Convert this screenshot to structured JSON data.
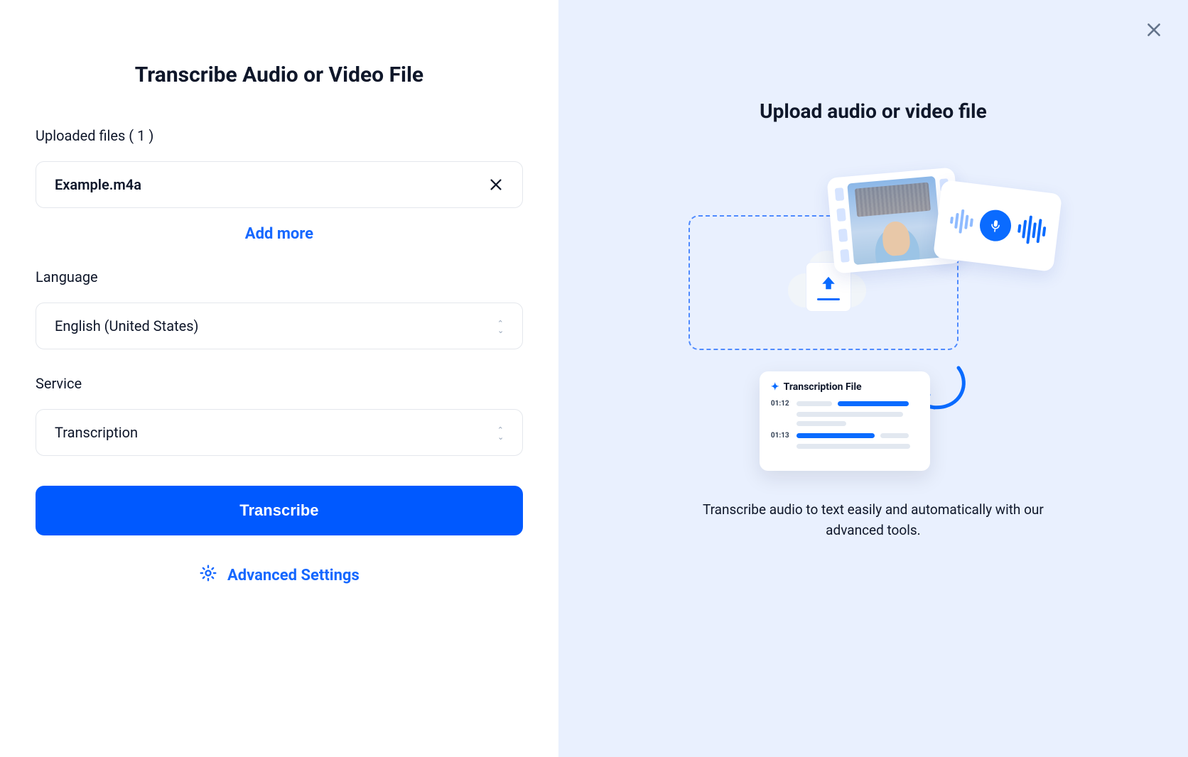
{
  "left": {
    "title": "Transcribe Audio or Video File",
    "uploaded_label": "Uploaded files ( 1 )",
    "file_name": "Example.m4a",
    "add_more": "Add more",
    "language_label": "Language",
    "language_value": "English (United States)",
    "service_label": "Service",
    "service_value": "Transcription",
    "transcribe_btn": "Transcribe",
    "advanced": "Advanced Settings"
  },
  "right": {
    "title": "Upload audio or video file",
    "trans_card_title": "Transcription File",
    "ts1": "01:12",
    "ts2": "01:13",
    "subtitle": "Transcribe audio to text easily and automatically with our advanced tools."
  }
}
